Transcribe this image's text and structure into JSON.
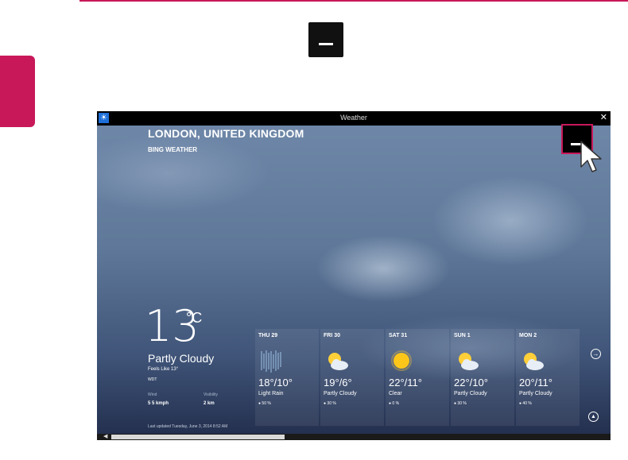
{
  "window": {
    "title": "Weather",
    "close_glyph": "✕",
    "app_icon": "sun-icon"
  },
  "location": {
    "city": "LONDON, UNITED KINGDOM",
    "provider": "BING WEATHER"
  },
  "current": {
    "temperature": "13",
    "unit": "°C",
    "condition": "Partly Cloudy",
    "feels_like": "Feels Like 13°",
    "station": "WDT",
    "wind_label": "Wind",
    "wind_value": "5 5 kmph",
    "visibility_label": "Visibility",
    "visibility_value": "2 km",
    "last_updated": "Last updated Tuesday, June 3, 2014 8:52 AM"
  },
  "forecast": [
    {
      "day": "THU 29",
      "temps": "18°/10°",
      "condition": "Light Rain",
      "precip": "50 %",
      "icon": "rain-icon"
    },
    {
      "day": "FRI 30",
      "temps": "19°/6°",
      "condition": "Partly Cloudy",
      "precip": "30 %",
      "icon": "partly-cloudy-icon"
    },
    {
      "day": "SAT 31",
      "temps": "22°/11°",
      "condition": "Clear",
      "precip": "0 %",
      "icon": "sun-icon"
    },
    {
      "day": "SUN 1",
      "temps": "22°/10°",
      "condition": "Partly Cloudy",
      "precip": "30 %",
      "icon": "partly-cloudy-icon"
    },
    {
      "day": "MON 2",
      "temps": "20°/11°",
      "condition": "Partly Cloudy",
      "precip": "40 %",
      "icon": "partly-cloudy-icon"
    }
  ],
  "colors": {
    "accent": "#c8185a",
    "titlebar": "#000000",
    "sky_dark": "#24304f"
  }
}
